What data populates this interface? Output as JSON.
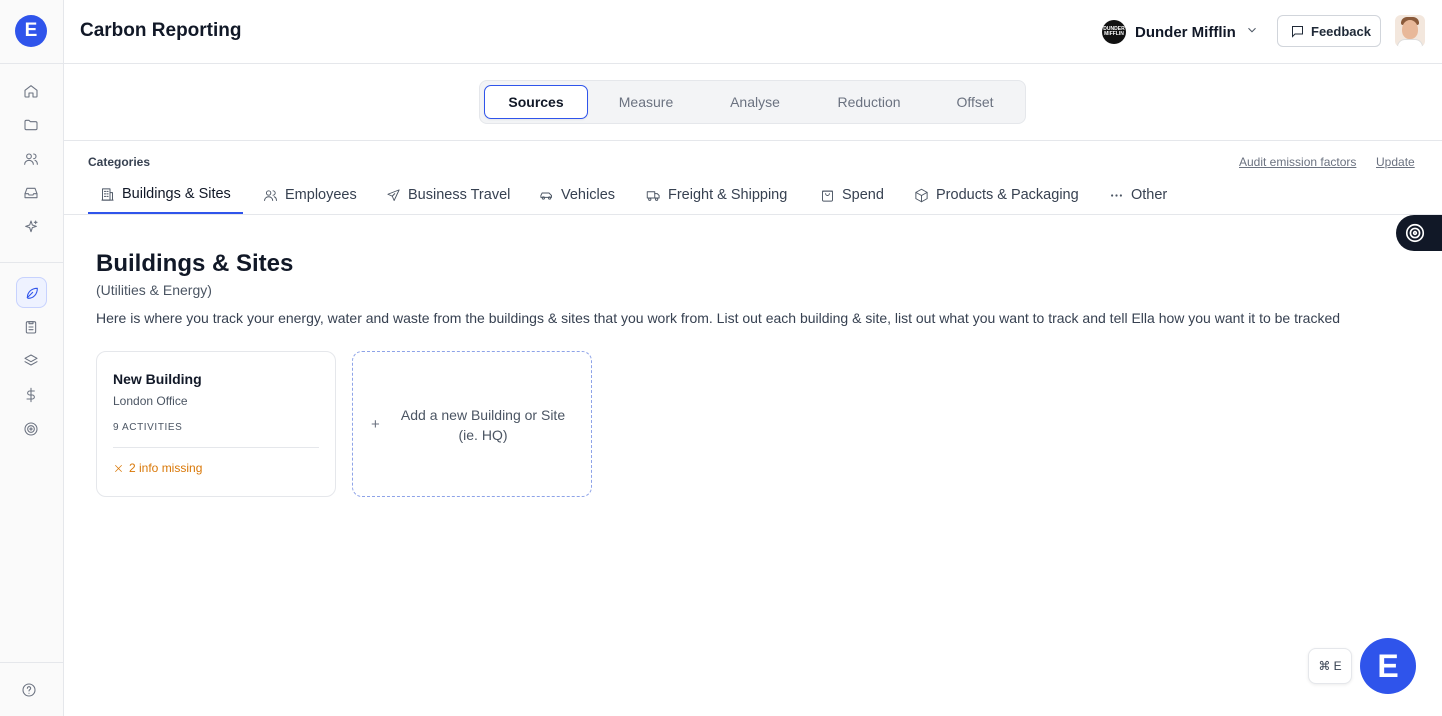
{
  "app": {
    "logo_letter": "E",
    "title": "Carbon Reporting"
  },
  "org": {
    "name": "Dunder Mifflin",
    "logo_text": "DUNDER MIFFLIN"
  },
  "header": {
    "feedback_label": "Feedback"
  },
  "main_tabs": [
    {
      "label": "Sources",
      "active": true
    },
    {
      "label": "Measure",
      "active": false
    },
    {
      "label": "Analyse",
      "active": false
    },
    {
      "label": "Reduction",
      "active": false
    },
    {
      "label": "Offset",
      "active": false
    }
  ],
  "categories": {
    "label": "Categories",
    "audit_link": "Audit emission factors",
    "update_link": "Update",
    "tabs": [
      {
        "label": "Buildings & Sites",
        "icon": "building-icon",
        "active": true
      },
      {
        "label": "Employees",
        "icon": "users-icon"
      },
      {
        "label": "Business Travel",
        "icon": "plane-icon"
      },
      {
        "label": "Vehicles",
        "icon": "car-icon"
      },
      {
        "label": "Freight & Shipping",
        "icon": "truck-icon"
      },
      {
        "label": "Spend",
        "icon": "shopping-bag-icon"
      },
      {
        "label": "Products & Packaging",
        "icon": "package-icon"
      },
      {
        "label": "Other",
        "icon": "more-icon"
      }
    ]
  },
  "page": {
    "title": "Buildings & Sites",
    "subtitle": "(Utilities & Energy)",
    "description": "Here is where you track your energy, water and waste from the buildings & sites that you work from. List out each building & site, list out what you want to track and tell Ella how you want it to be tracked"
  },
  "cards": [
    {
      "title": "New Building",
      "subtitle": "London Office",
      "count": "9 ACTIVITIES",
      "warning": "2 info missing"
    }
  ],
  "add_card": {
    "plus": "+",
    "text": "Add a new Building or Site (ie. HQ)"
  },
  "shortcut": {
    "label": "⌘ E"
  },
  "assistant": {
    "letter": "E"
  },
  "colors": {
    "accent": "#2f54eb",
    "warning": "#d97706",
    "text": "#111827"
  }
}
